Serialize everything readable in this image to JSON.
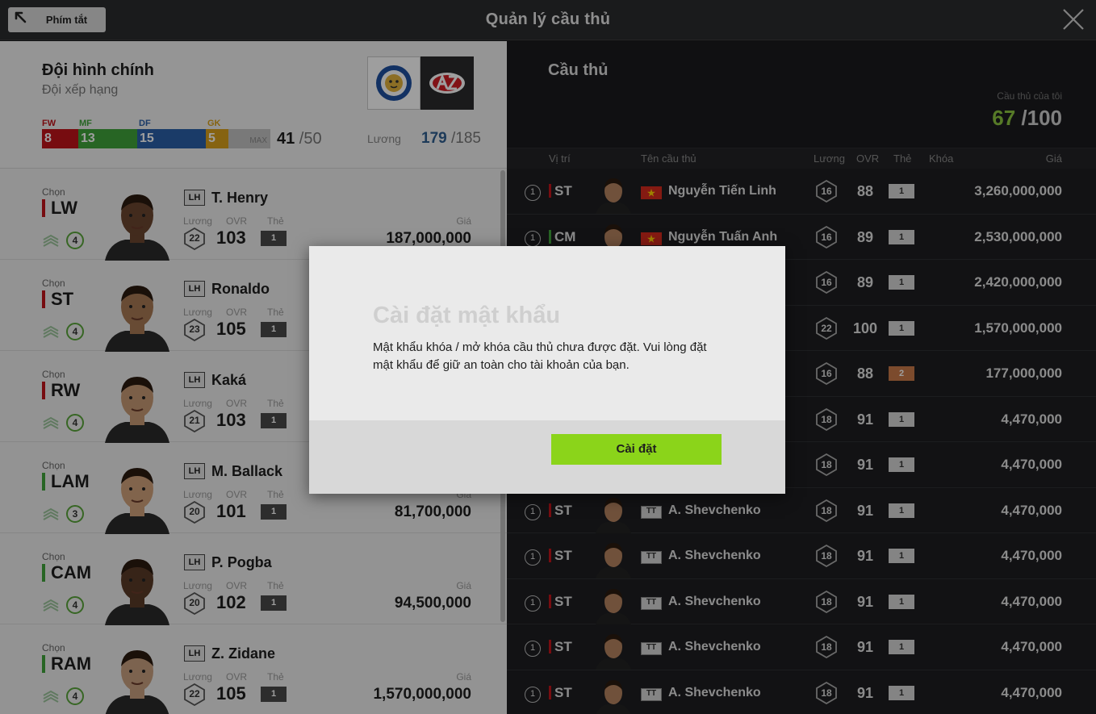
{
  "header": {
    "shortcut_label": "Phím tắt",
    "title": "Quản lý cầu thủ"
  },
  "squad": {
    "title": "Đội hình chính",
    "subtitle": "Đội xếp hạng",
    "positions": {
      "fw_label": "FW",
      "fw_count": "8",
      "mf_label": "MF",
      "mf_count": "13",
      "df_label": "DF",
      "df_count": "15",
      "gk_label": "GK",
      "gk_count": "5",
      "max_label": "MAX"
    },
    "count": "41",
    "count_total": " /50",
    "salary_label": "Lương",
    "salary": "179",
    "salary_total": " /185",
    "colors": {
      "fw": "#c0141b",
      "mf": "#3fa33a",
      "df": "#2b5fa8",
      "gk": "#d9a11c"
    }
  },
  "players": [
    {
      "choose": "Chọn",
      "pos": "LW",
      "level": "4",
      "tag": "LH",
      "name": "T. Henry",
      "salary_label": "Lương",
      "ovr_label": "OVR",
      "card_label": "Thẻ",
      "salary": "22",
      "ovr": "103",
      "card": "1",
      "price_label": "Giá",
      "price": "187,000,000",
      "pos_color": "#c0141b"
    },
    {
      "choose": "Chọn",
      "pos": "ST",
      "level": "4",
      "tag": "LH",
      "name": "Ronaldo",
      "salary_label": "Lương",
      "ovr_label": "OVR",
      "card_label": "Thẻ",
      "salary": "23",
      "ovr": "105",
      "card": "1",
      "price_label": "",
      "price": "",
      "pos_color": "#c0141b"
    },
    {
      "choose": "Chọn",
      "pos": "RW",
      "level": "4",
      "tag": "LH",
      "name": "Kaká",
      "salary_label": "Lương",
      "ovr_label": "OVR",
      "card_label": "Thẻ",
      "salary": "21",
      "ovr": "103",
      "card": "1",
      "price_label": "",
      "price": "",
      "pos_color": "#c0141b"
    },
    {
      "choose": "Chọn",
      "pos": "LAM",
      "level": "3",
      "tag": "LH",
      "name": "M. Ballack",
      "salary_label": "Lương",
      "ovr_label": "OVR",
      "card_label": "Thẻ",
      "salary": "20",
      "ovr": "101",
      "card": "1",
      "price_label": "Giá",
      "price": "81,700,000",
      "pos_color": "#3fa33a"
    },
    {
      "choose": "Chọn",
      "pos": "CAM",
      "level": "4",
      "tag": "LH",
      "name": "P. Pogba",
      "salary_label": "Lương",
      "ovr_label": "OVR",
      "card_label": "Thẻ",
      "salary": "20",
      "ovr": "102",
      "card": "1",
      "price_label": "Giá",
      "price": "94,500,000",
      "pos_color": "#3fa33a"
    },
    {
      "choose": "Chọn",
      "pos": "RAM",
      "level": "4",
      "tag": "LH",
      "name": "Z. Zidane",
      "salary_label": "Lương",
      "ovr_label": "OVR",
      "card_label": "Thẻ",
      "salary": "22",
      "ovr": "105",
      "card": "1",
      "price_label": "Giá",
      "price": "1,570,000,000",
      "pos_color": "#3fa33a"
    }
  ],
  "market": {
    "title": "Cầu thủ",
    "my_label": "Cầu thủ của tôi",
    "my_count": "67",
    "my_total": " /100",
    "columns": {
      "pos": "Vị trí",
      "name": "Tên cầu thủ",
      "salary": "Lương",
      "ovr": "OVR",
      "card": "Thẻ",
      "lock": "Khóa",
      "price": "Giá"
    },
    "rows": [
      {
        "num": "1",
        "pos": "ST",
        "mf": false,
        "badge": "vn",
        "name": "Nguyễn Tiến Linh",
        "salary": "16",
        "ovr": "88",
        "card": "1",
        "bronze": false,
        "price": "3,260,000,000"
      },
      {
        "num": "1",
        "pos": "CM",
        "mf": true,
        "badge": "vn",
        "name": "Nguyễn Tuấn Anh",
        "salary": "16",
        "ovr": "89",
        "card": "1",
        "bronze": false,
        "price": "2,530,000,000"
      },
      {
        "num": "",
        "pos": "",
        "mf": false,
        "badge": "",
        "name": "",
        "salary": "16",
        "ovr": "89",
        "card": "1",
        "bronze": false,
        "price": "2,420,000,000"
      },
      {
        "num": "",
        "pos": "",
        "mf": false,
        "badge": "",
        "name": "",
        "salary": "22",
        "ovr": "100",
        "card": "1",
        "bronze": false,
        "price": "1,570,000,000"
      },
      {
        "num": "",
        "pos": "",
        "mf": false,
        "badge": "",
        "name": "",
        "salary": "16",
        "ovr": "88",
        "card": "2",
        "bronze": true,
        "price": "177,000,000"
      },
      {
        "num": "",
        "pos": "",
        "mf": false,
        "badge": "",
        "name": "",
        "salary": "18",
        "ovr": "91",
        "card": "1",
        "bronze": false,
        "price": "4,470,000"
      },
      {
        "num": "",
        "pos": "",
        "mf": false,
        "badge": "",
        "name": "",
        "salary": "18",
        "ovr": "91",
        "card": "1",
        "bronze": false,
        "price": "4,470,000"
      },
      {
        "num": "1",
        "pos": "ST",
        "mf": false,
        "badge": "tt",
        "name": "A. Shevchenko",
        "salary": "18",
        "ovr": "91",
        "card": "1",
        "bronze": false,
        "price": "4,470,000"
      },
      {
        "num": "1",
        "pos": "ST",
        "mf": false,
        "badge": "tt",
        "name": "A. Shevchenko",
        "salary": "18",
        "ovr": "91",
        "card": "1",
        "bronze": false,
        "price": "4,470,000"
      },
      {
        "num": "1",
        "pos": "ST",
        "mf": false,
        "badge": "tt",
        "name": "A. Shevchenko",
        "salary": "18",
        "ovr": "91",
        "card": "1",
        "bronze": false,
        "price": "4,470,000"
      },
      {
        "num": "1",
        "pos": "ST",
        "mf": false,
        "badge": "tt",
        "name": "A. Shevchenko",
        "salary": "18",
        "ovr": "91",
        "card": "1",
        "bronze": false,
        "price": "4,470,000"
      },
      {
        "num": "1",
        "pos": "ST",
        "mf": false,
        "badge": "tt",
        "name": "A. Shevchenko",
        "salary": "18",
        "ovr": "91",
        "card": "1",
        "bronze": false,
        "price": "4,470,000"
      }
    ]
  },
  "dialog": {
    "title": "Cài đặt mật khẩu",
    "body": "Mật khẩu khóa / mở khóa cầu thủ chưa được đặt. Vui lòng đặt mật khẩu để giữ an toàn cho tài khoản của bạn.",
    "button": "Cài đặt"
  },
  "badge_tt": "TT"
}
